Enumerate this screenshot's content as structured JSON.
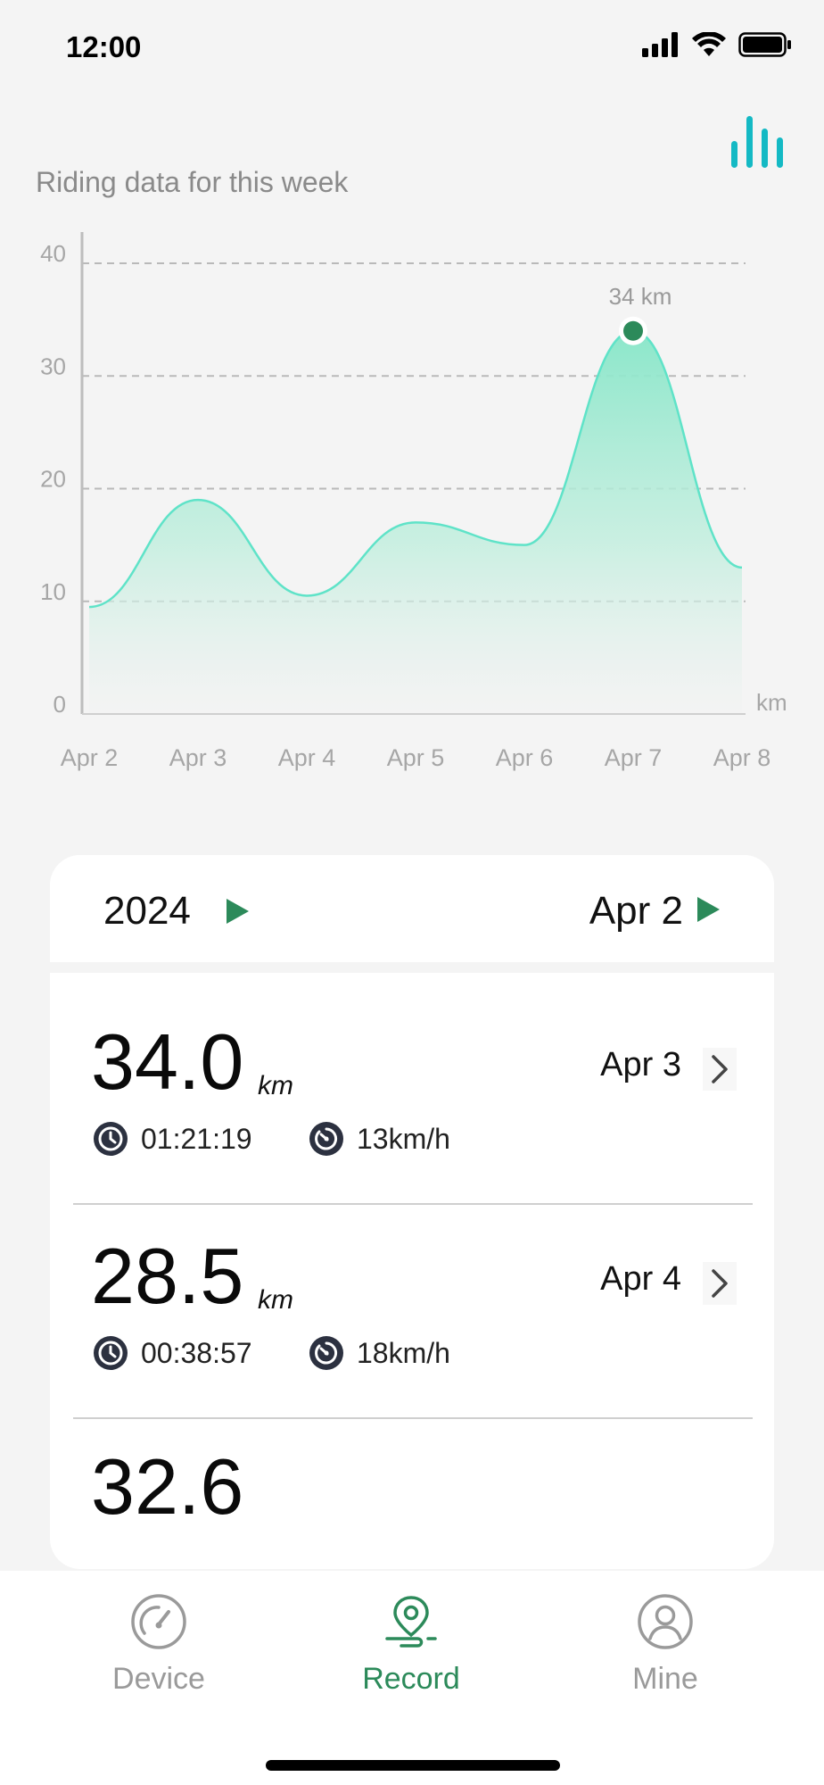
{
  "status": {
    "time": "12:00"
  },
  "chart_title": "Riding data for this week",
  "chart_data": {
    "type": "area",
    "y_ticks": [
      "40",
      "30",
      "20",
      "10",
      "0"
    ],
    "y_unit": "km",
    "ylim": [
      0,
      40
    ],
    "categories": [
      "Apr 2",
      "Apr 3",
      "Apr 4",
      "Apr 5",
      "Apr 6",
      "Apr 7",
      "Apr 8"
    ],
    "values": [
      9.5,
      19,
      10.5,
      17,
      15,
      34,
      13
    ],
    "highlight": {
      "category": "Apr 7",
      "value": 34,
      "label": "34 km"
    },
    "grid": "dashed-horizontal",
    "line_color": "#5fe3c8",
    "fill_color": "#86e6c8",
    "marker_color": "#2c8a5a"
  },
  "filter": {
    "year": "2024",
    "date": "Apr 2",
    "arrow_color": "#2c8a5a"
  },
  "rides": [
    {
      "distance": "34.0",
      "unit": "km",
      "date": "Apr 3",
      "duration": "01:21:19",
      "speed": "13km/h"
    },
    {
      "distance": "28.5",
      "unit": "km",
      "date": "Apr 4",
      "duration": "00:38:57",
      "speed": "18km/h"
    },
    {
      "distance": "32.6"
    }
  ],
  "tabs": [
    {
      "label": "Device",
      "icon": "speedometer-icon"
    },
    {
      "label": "Record",
      "icon": "route-pin-icon",
      "active": true
    },
    {
      "label": "Mine",
      "icon": "user-icon"
    }
  ]
}
